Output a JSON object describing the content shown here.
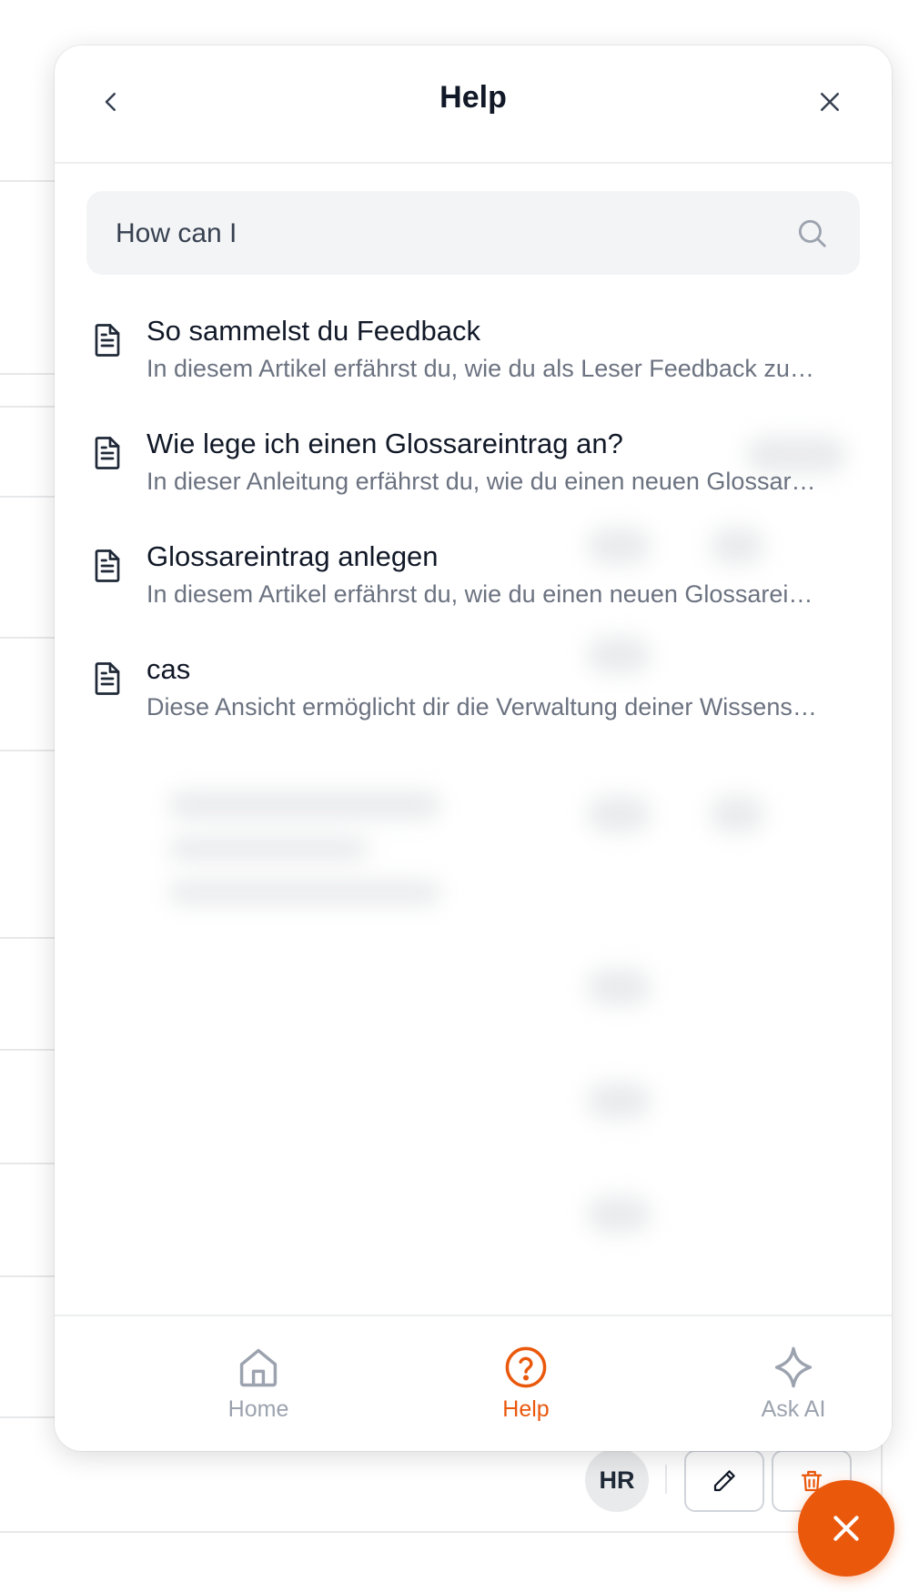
{
  "header": {
    "title": "Help"
  },
  "search": {
    "value": "How can I",
    "placeholder": ""
  },
  "results": [
    {
      "title": "So sammelst du Feedback",
      "description": "In diesem Artikel erfährst du, wie du als Leser Feedback zu…"
    },
    {
      "title": "Wie lege ich einen Glossareintrag an?",
      "description": "In dieser Anleitung erfährst du, wie du einen neuen Glossar…"
    },
    {
      "title": "Glossareintrag anlegen",
      "description": "In diesem Artikel erfährst du, wie du einen neuen Glossarei…"
    },
    {
      "title": "cas",
      "description": "Diese Ansicht ermöglicht dir die Verwaltung deiner Wissens…"
    }
  ],
  "nav": {
    "home_label": "Home",
    "help_label": "Help",
    "ask_ai_label": "Ask AI",
    "active": "help"
  },
  "background": {
    "avatar_initials": "HR"
  },
  "colors": {
    "accent": "#ea580c",
    "text": "#111827",
    "muted": "#6b7280"
  },
  "icons": [
    "chevron-left-icon",
    "close-icon",
    "search-icon",
    "document-icon",
    "home-icon",
    "question-circle-icon",
    "sparkle-icon",
    "pencil-icon",
    "trash-icon"
  ]
}
